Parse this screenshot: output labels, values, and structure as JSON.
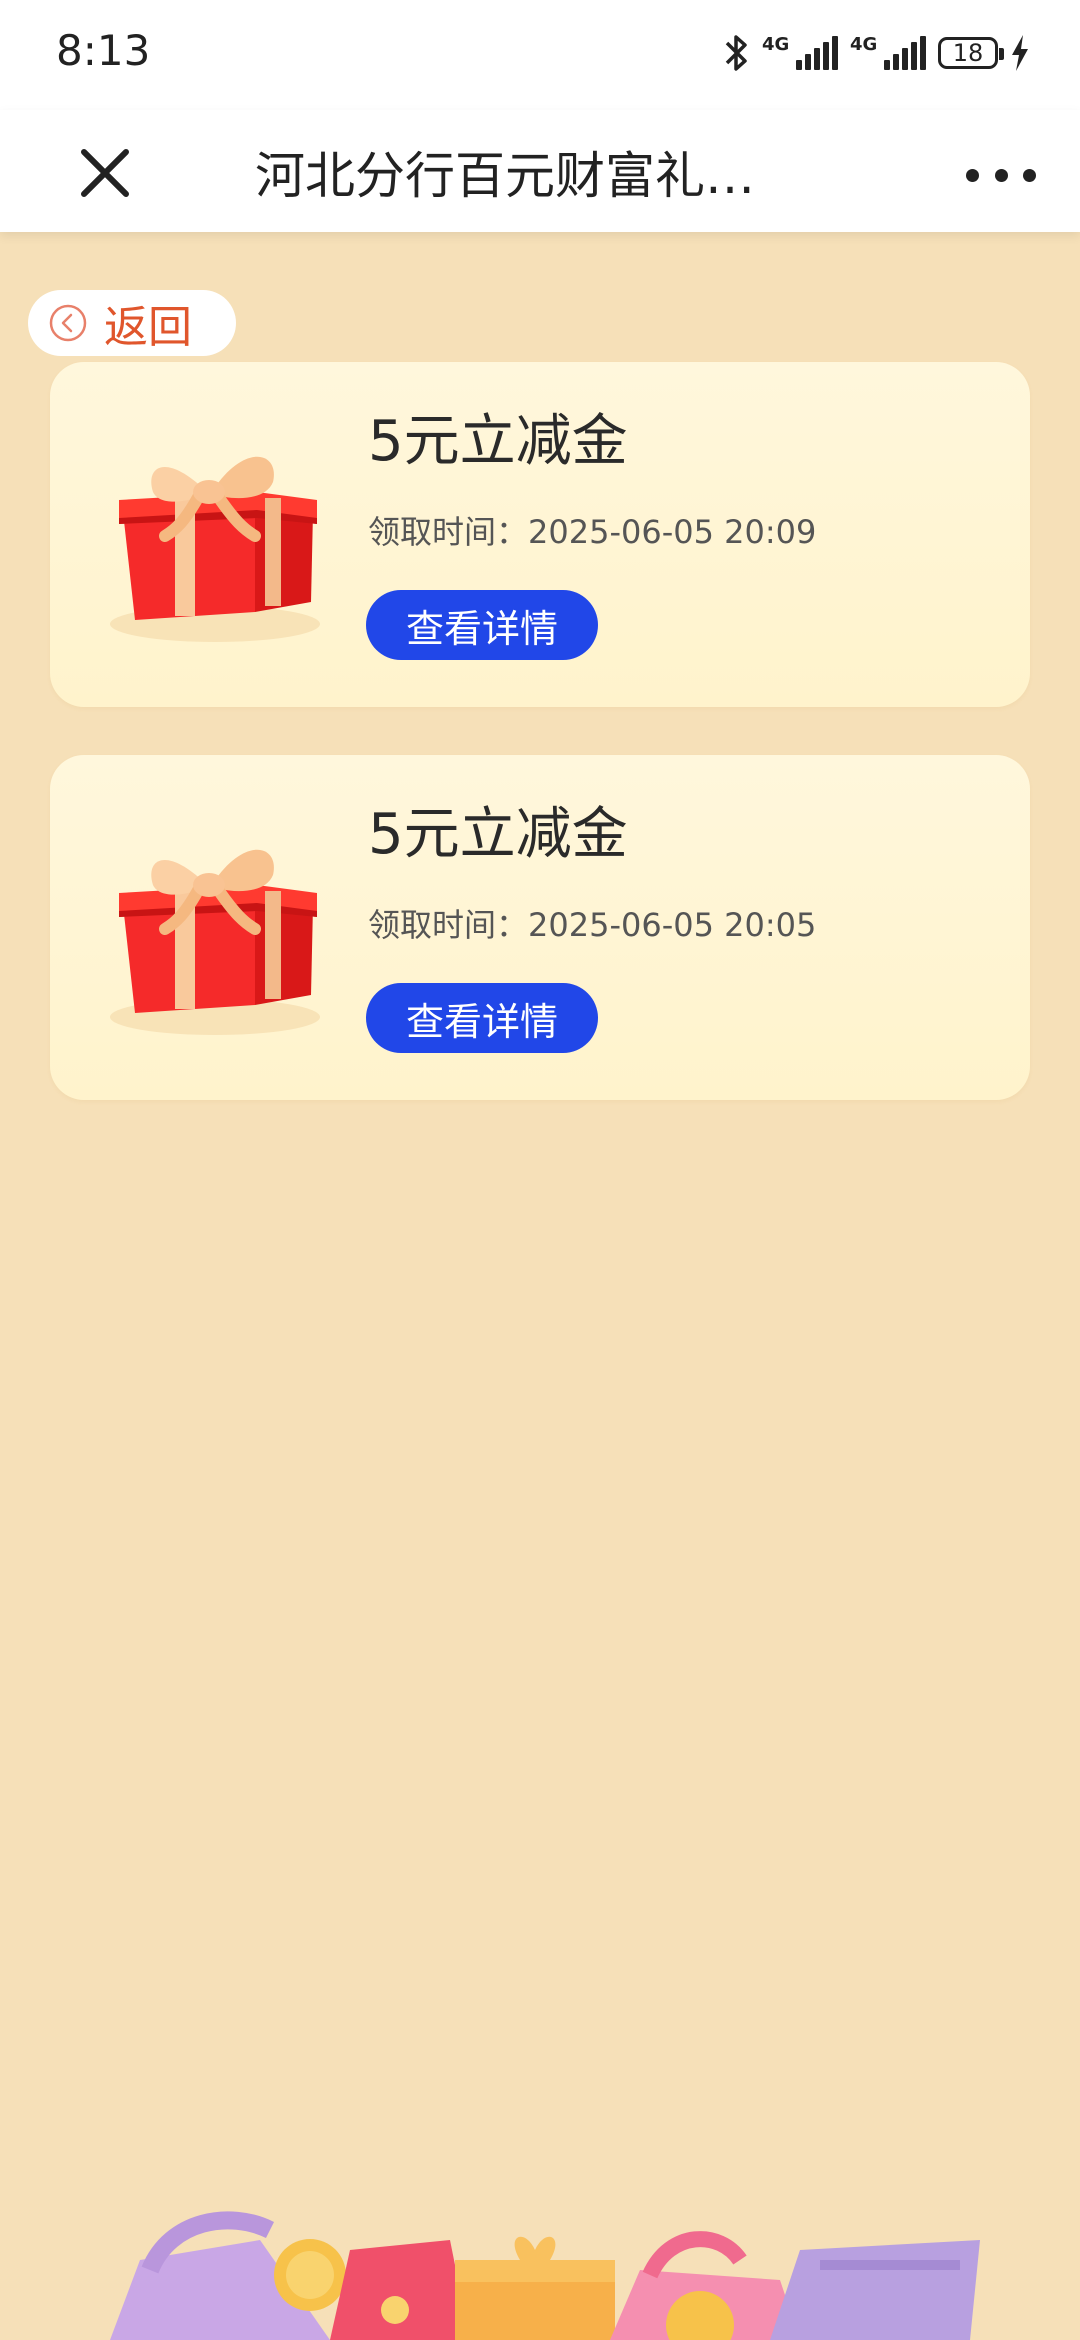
{
  "status": {
    "time": "8:13",
    "signal1_label": "4G",
    "signal2_label": "4G",
    "battery": "18"
  },
  "header": {
    "title": "河北分行百元财富礼…"
  },
  "back": {
    "label": "返回"
  },
  "cards": [
    {
      "title": "5元立减金",
      "time": "领取时间：2025-06-05 20:09",
      "button": "查看详情"
    },
    {
      "title": "5元立减金",
      "time": "领取时间：2025-06-05 20:05",
      "button": "查看详情"
    }
  ],
  "colors": {
    "background": "#f6e0b8",
    "card": "#fff5d4",
    "button": "#2147e8",
    "back_text": "#e0562c"
  }
}
